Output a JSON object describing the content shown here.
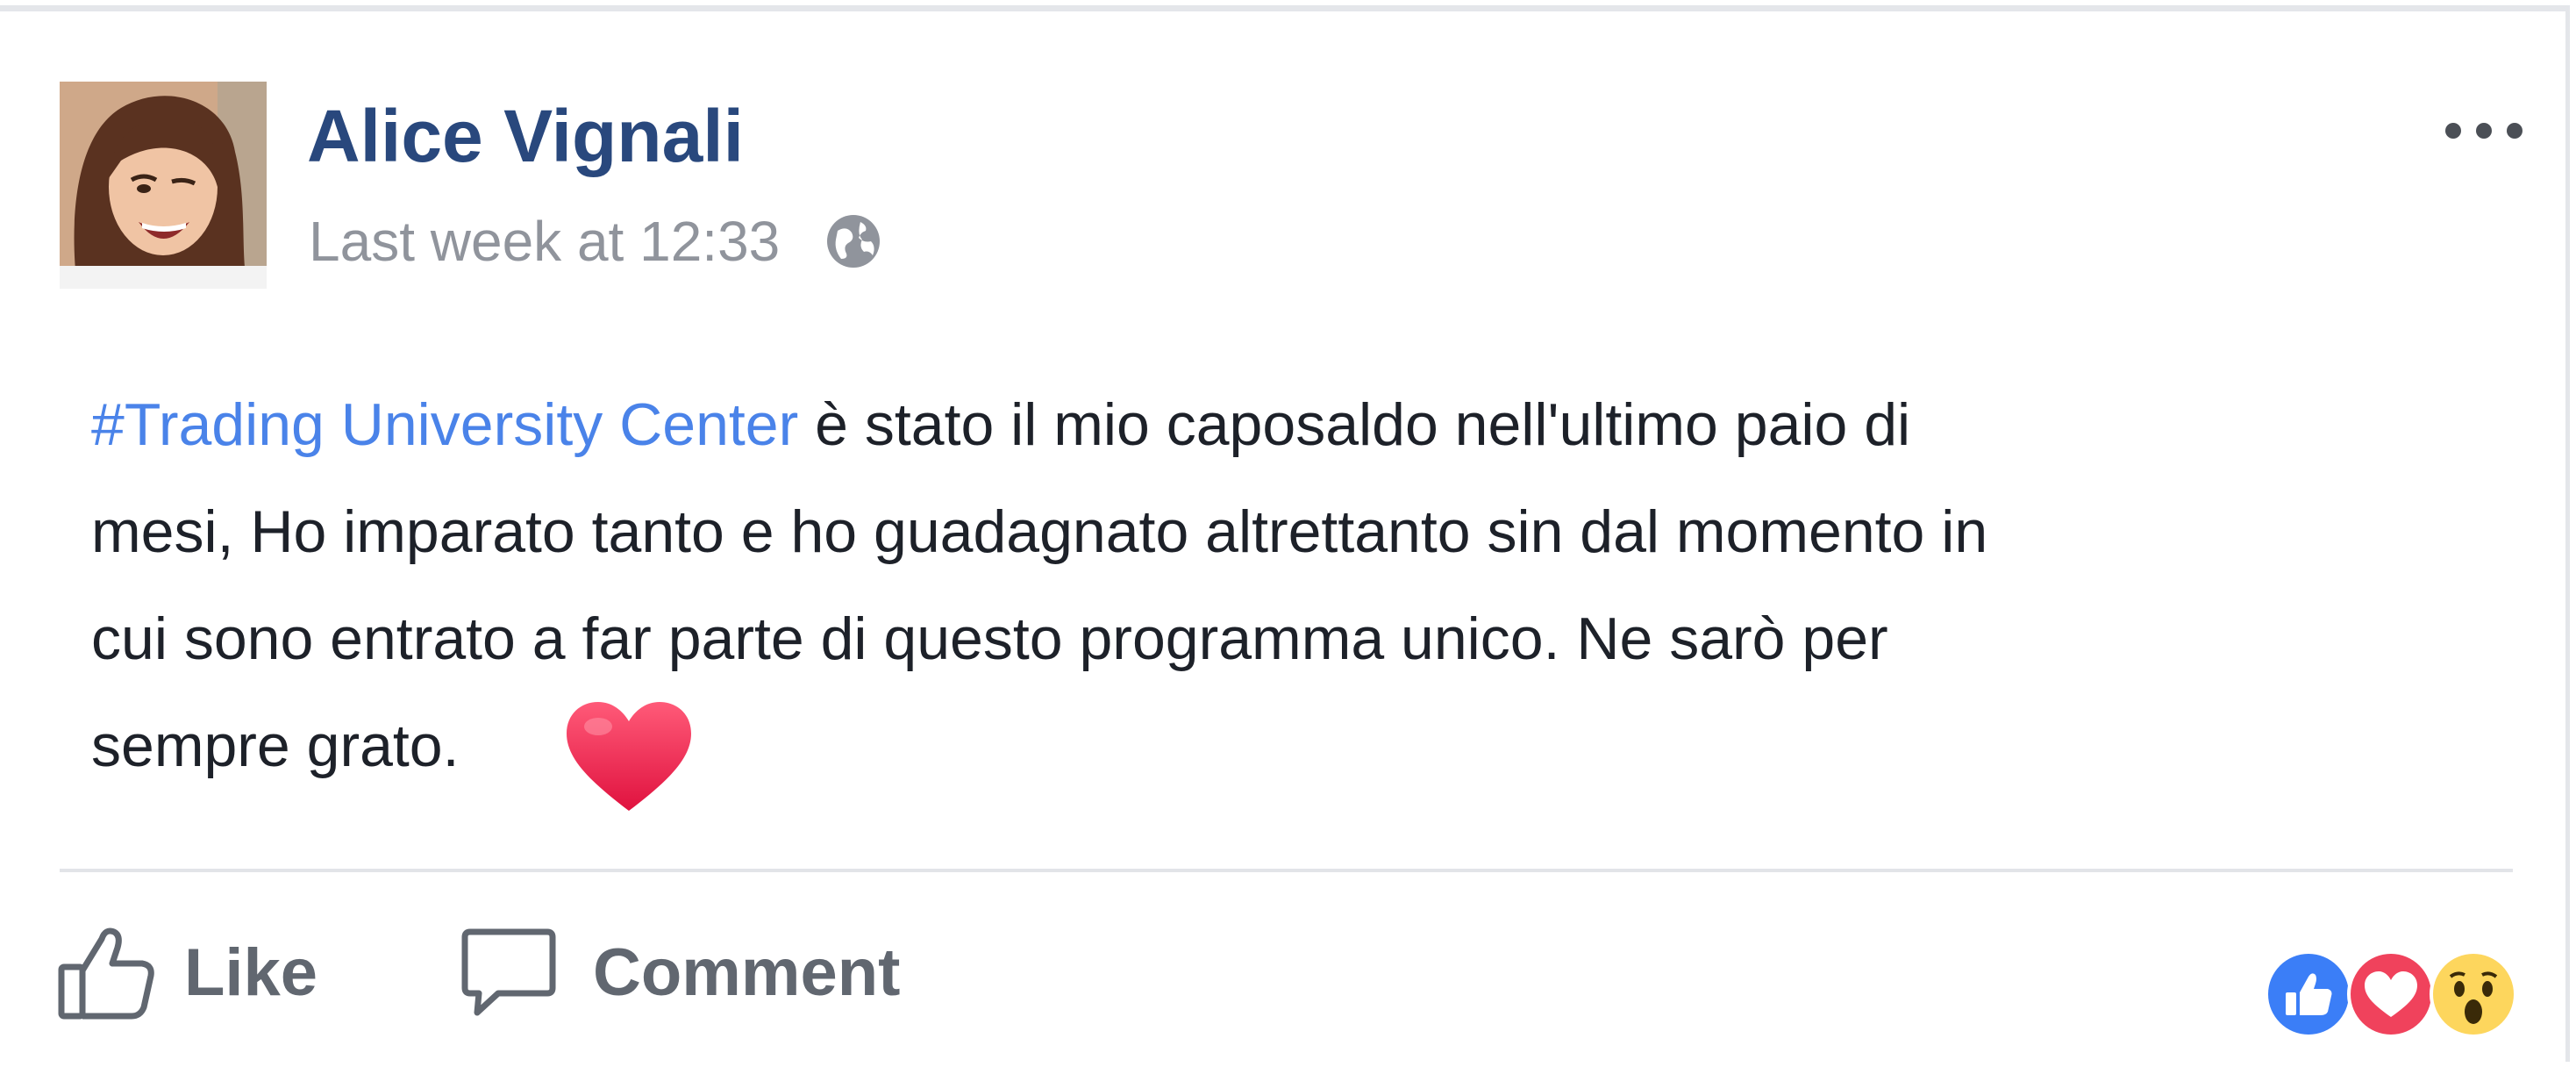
{
  "post": {
    "author": "Alice Vignali",
    "timestamp": "Last week at 12:33",
    "audience_icon": "globe-icon",
    "menu_icon": "more-options-icon",
    "hashtag": "#Trading University Center",
    "text_line1_rest": " è stato il mio caposaldo nell'ultimo paio di",
    "text_line2": "mesi,  Ho imparato tanto e ho guadagnato altrettanto sin dal momento in",
    "text_line3": "cui sono entrato a far parte di questo programma unico. Ne sarò per",
    "text_line4": "sempre grato.",
    "emoji": "heart-emoji"
  },
  "actions": {
    "like_label": "Like",
    "like_icon": "thumbs-up-icon",
    "comment_label": "Comment",
    "comment_icon": "comment-bubble-icon"
  },
  "reactions": [
    "like-reaction-icon",
    "love-reaction-icon",
    "wow-reaction-icon"
  ],
  "colors": {
    "author": "#29487d",
    "hashtag": "#4a83e9",
    "meta": "#90949c",
    "action": "#616770",
    "like_reaction": "#3b7ef7",
    "love_reaction": "#f0425c",
    "wow_reaction": "#fdd65d"
  }
}
